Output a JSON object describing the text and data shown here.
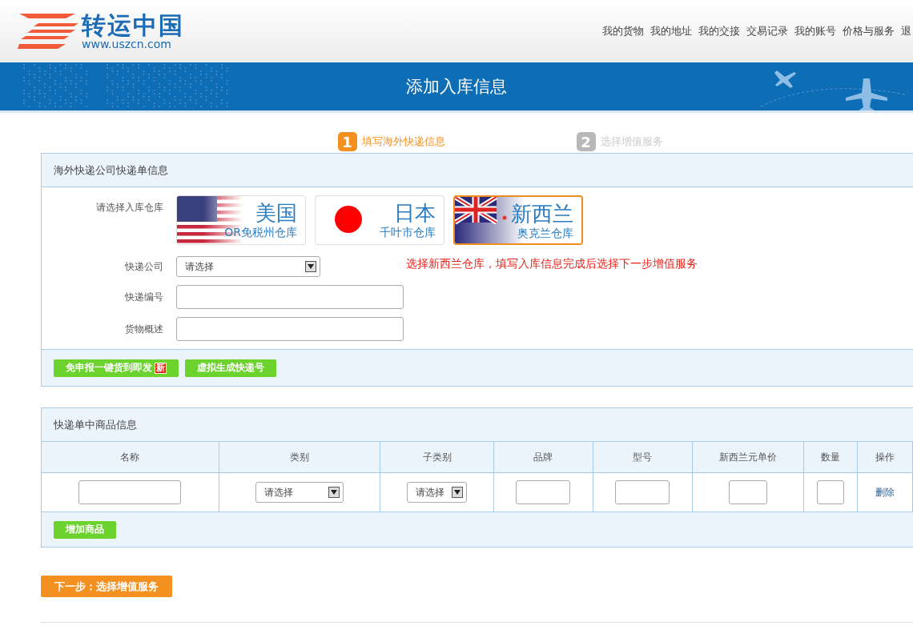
{
  "header": {
    "logo": {
      "name": "转运中国",
      "url": "www.uszcn.com"
    },
    "nav": [
      "我的货物",
      "我的地址",
      "我的交接",
      "交易记录",
      "我的账号",
      "价格与服务",
      "退"
    ]
  },
  "banner": {
    "title": "添加入库信息"
  },
  "steps": [
    {
      "number": "1",
      "label": "填写海外快递信息",
      "selected": true
    },
    {
      "number": "2",
      "label": "选择增值服务",
      "selected": false
    }
  ],
  "express_panel": {
    "title": "海外快递公司快递单信息",
    "warehouse_label": "请选择入库仓库",
    "warehouses": [
      {
        "kind": "us",
        "name": "美国",
        "sub": "OR免税州仓库",
        "selected": false
      },
      {
        "kind": "jp",
        "name": "日本",
        "sub": "千叶市仓库",
        "selected": false
      },
      {
        "kind": "nz",
        "name": "新西兰",
        "sub": "奥克兰仓库",
        "selected": true
      }
    ],
    "hint": "选择新西兰仓库，填写入库信息完成后选择下一步增值服务",
    "fields": [
      {
        "label": "快递公司",
        "kind": "select",
        "value": "请选择"
      },
      {
        "label": "快递编号",
        "kind": "input"
      },
      {
        "label": "货物概述",
        "kind": "input"
      }
    ],
    "buttons": [
      {
        "label": "免申报一键货到即发",
        "badge": "新"
      },
      {
        "label": "虚拟生成快递号"
      }
    ]
  },
  "goods_panel": {
    "title": "快递单中商品信息",
    "columns": [
      "名称",
      "类别",
      "子类别",
      "品牌",
      "型号",
      "新西兰元单价",
      "数量",
      "操作"
    ],
    "rows": [
      [
        {
          "kind": "input"
        },
        {
          "kind": "select",
          "value": "请选择"
        },
        {
          "kind": "select",
          "value": "请选择"
        },
        {
          "kind": "input"
        },
        {
          "kind": "input"
        },
        {
          "kind": "input"
        },
        {
          "kind": "input"
        },
        {
          "kind": "link",
          "text": "删除"
        }
      ]
    ],
    "add_button": "增加商品"
  },
  "next_button": "下一步：选择增值服务"
}
